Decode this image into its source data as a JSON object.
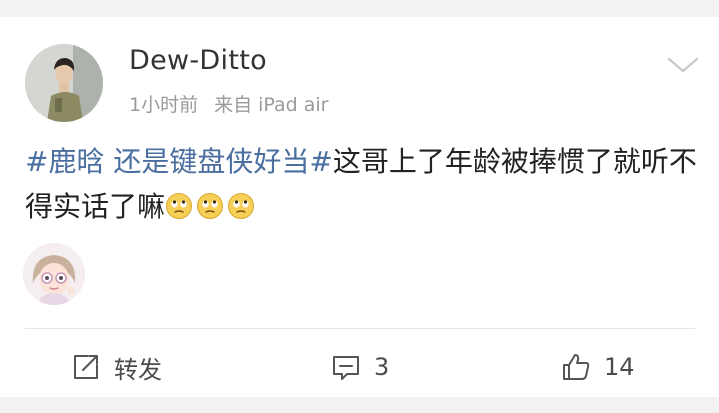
{
  "post": {
    "username": "Dew-Ditto",
    "time": "1小时前",
    "source": "来自 iPad air",
    "topic_text": "#鹿晗 还是键盘侠好当#",
    "body_text": "这哥上了年龄被捧惯了就听不得实话了嘛",
    "emoji": [
      "rolling-eyes-emoji",
      "rolling-eyes-emoji",
      "rolling-eyes-emoji"
    ]
  },
  "actions": {
    "repost_label": "转发",
    "comment_count": "3",
    "like_count": "14"
  },
  "colors": {
    "topic_link": "#4a6fa0",
    "meta_text": "#9a9a9a",
    "background": "#f2f2f2"
  }
}
